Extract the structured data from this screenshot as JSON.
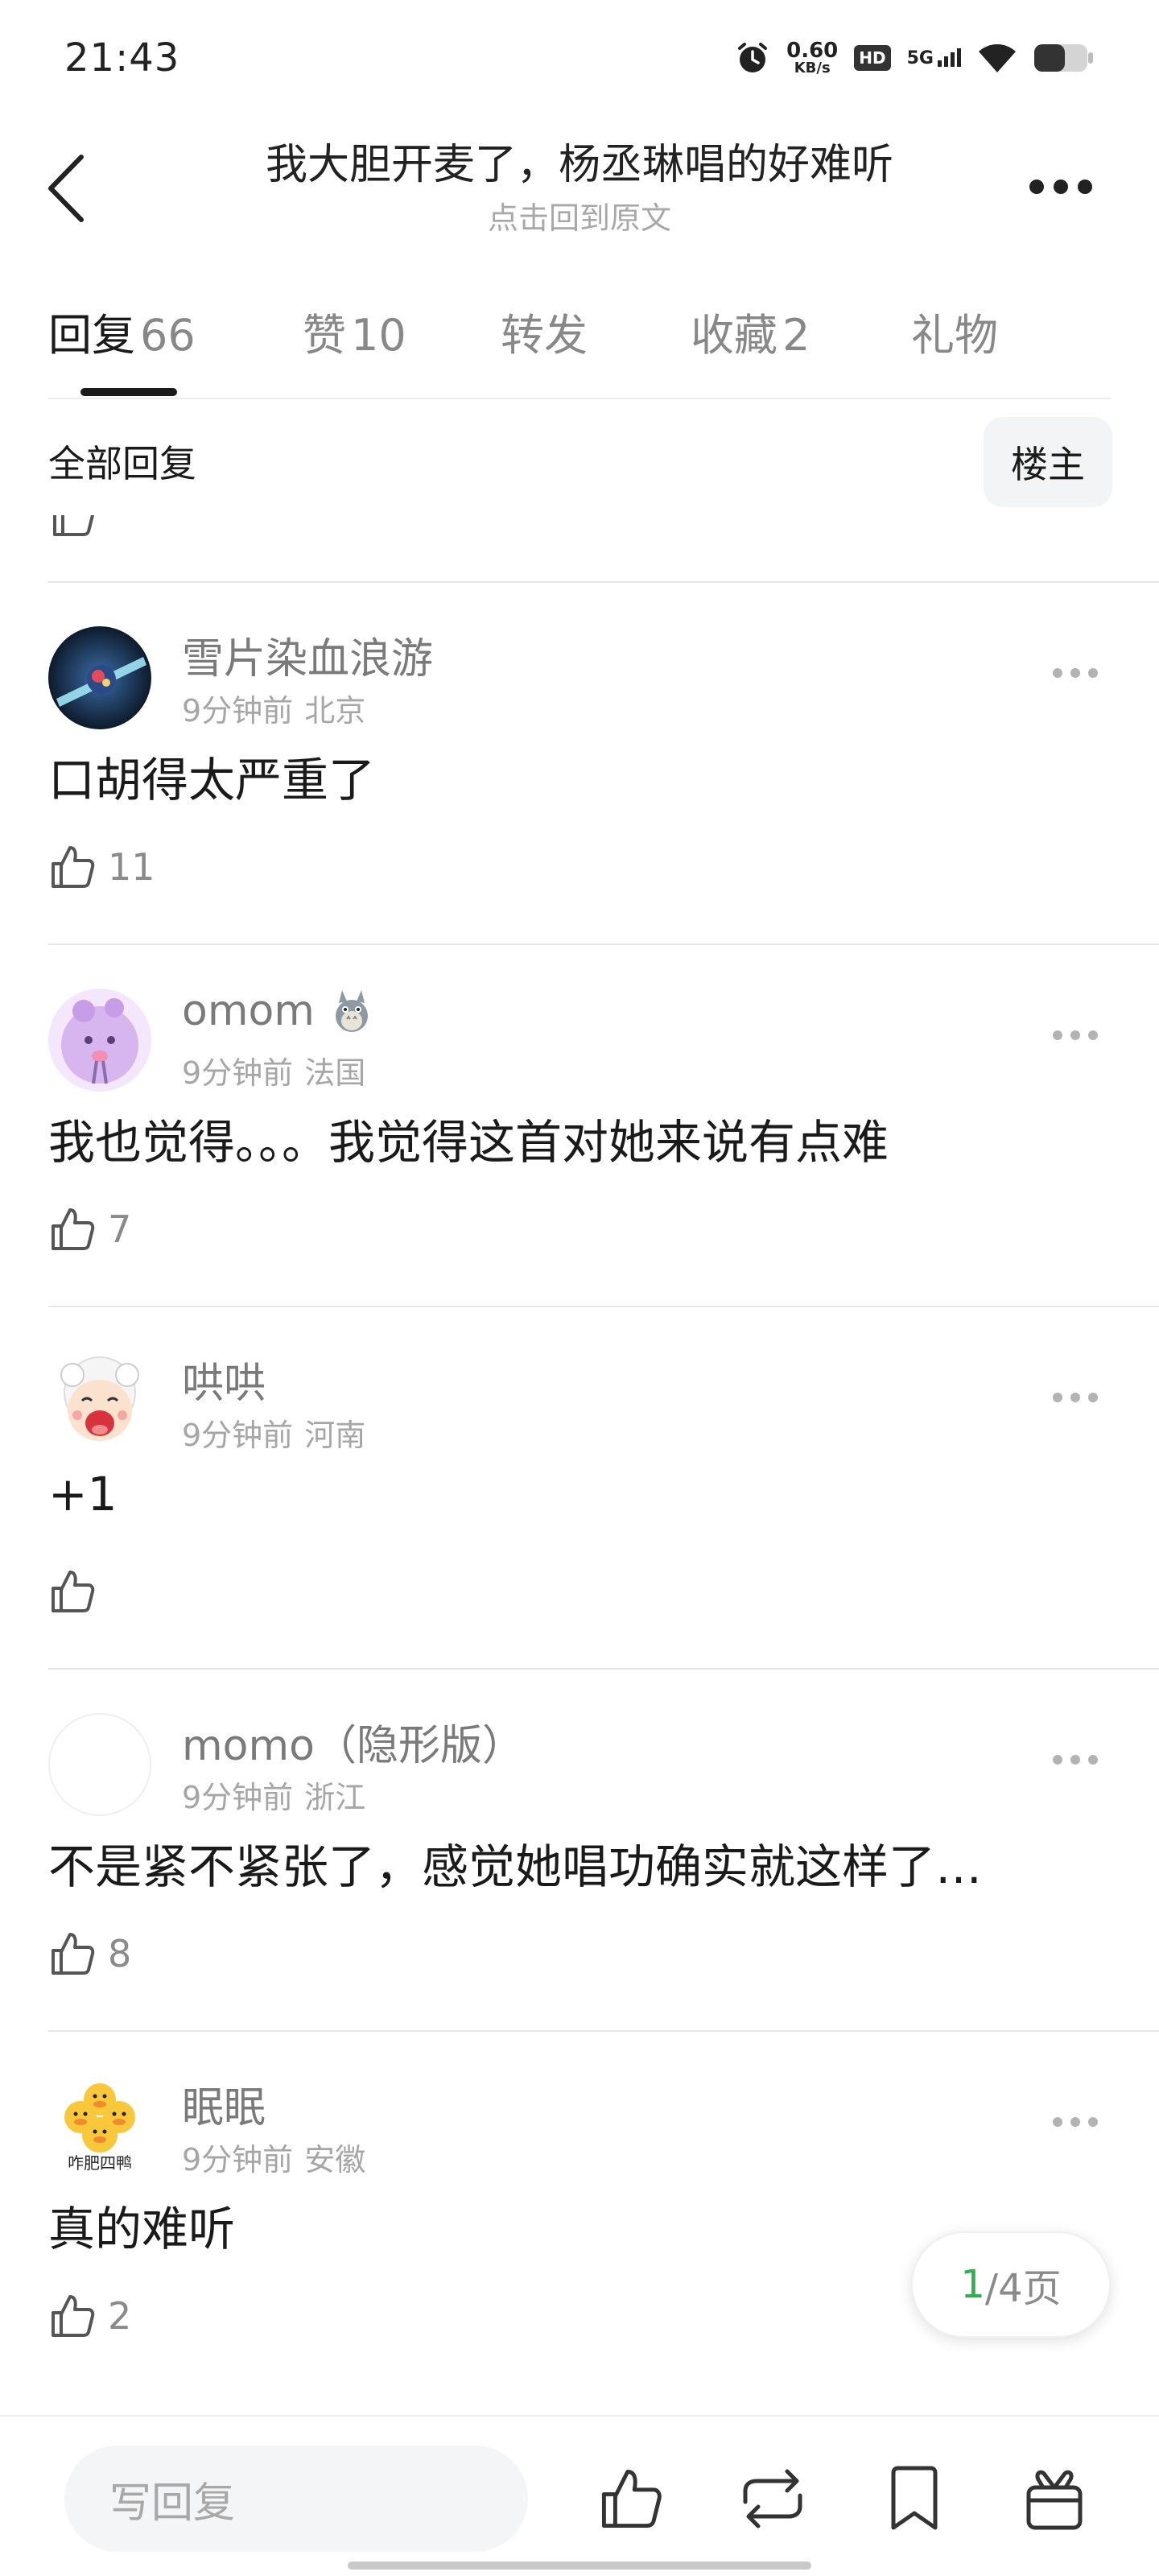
{
  "status_bar": {
    "time": "21:43",
    "net_speed_value": "0.60",
    "net_speed_unit": "KB/s",
    "hd": "HD",
    "network": "5G",
    "icons": [
      "alarm-icon",
      "hd-icon",
      "signal-icon",
      "wifi-icon",
      "battery-icon"
    ]
  },
  "header": {
    "title": "我大胆开麦了，杨丞琳唱的好难听",
    "subtitle": "点击回到原文"
  },
  "tabs": [
    {
      "label": "回复",
      "count": "66",
      "active": true
    },
    {
      "label": "赞",
      "count": "10",
      "active": false
    },
    {
      "label": "转发",
      "count": "",
      "active": false
    },
    {
      "label": "收藏",
      "count": "2",
      "active": false
    },
    {
      "label": "礼物",
      "count": "",
      "active": false
    }
  ],
  "filter": {
    "label": "全部回复",
    "owner_button": "楼主"
  },
  "comments": [
    {
      "name": "雪片染血浪游",
      "time": "9分钟前",
      "location": "北京",
      "text": "口胡得太严重了",
      "likes": "11"
    },
    {
      "name": "omom",
      "time": "9分钟前",
      "location": "法国",
      "text": "我也觉得。。。我觉得这首对她来说有点难",
      "likes": "7"
    },
    {
      "name": "哄哄",
      "time": "9分钟前",
      "location": "河南",
      "text": "+1",
      "likes": ""
    },
    {
      "name": "momo（隐形版）",
      "time": "9分钟前",
      "location": "浙江",
      "text": "不是紧不紧张了，感觉她唱功确实就这样了…",
      "likes": "8"
    },
    {
      "name": "眠眠",
      "time": "9分钟前",
      "location": "安徽",
      "text": "真的难听",
      "likes": "2",
      "avatar_caption": "咋肥四鸭"
    }
  ],
  "pagination": {
    "current": "1",
    "total_text": "/4页"
  },
  "bottom_bar": {
    "reply_placeholder": "写回复",
    "icons": [
      "like-icon",
      "repost-icon",
      "bookmark-icon",
      "gift-icon"
    ]
  },
  "colors": {
    "accent_green": "#2bb24c",
    "text_primary": "#1a1a1a",
    "text_secondary": "#8a8a8a"
  }
}
